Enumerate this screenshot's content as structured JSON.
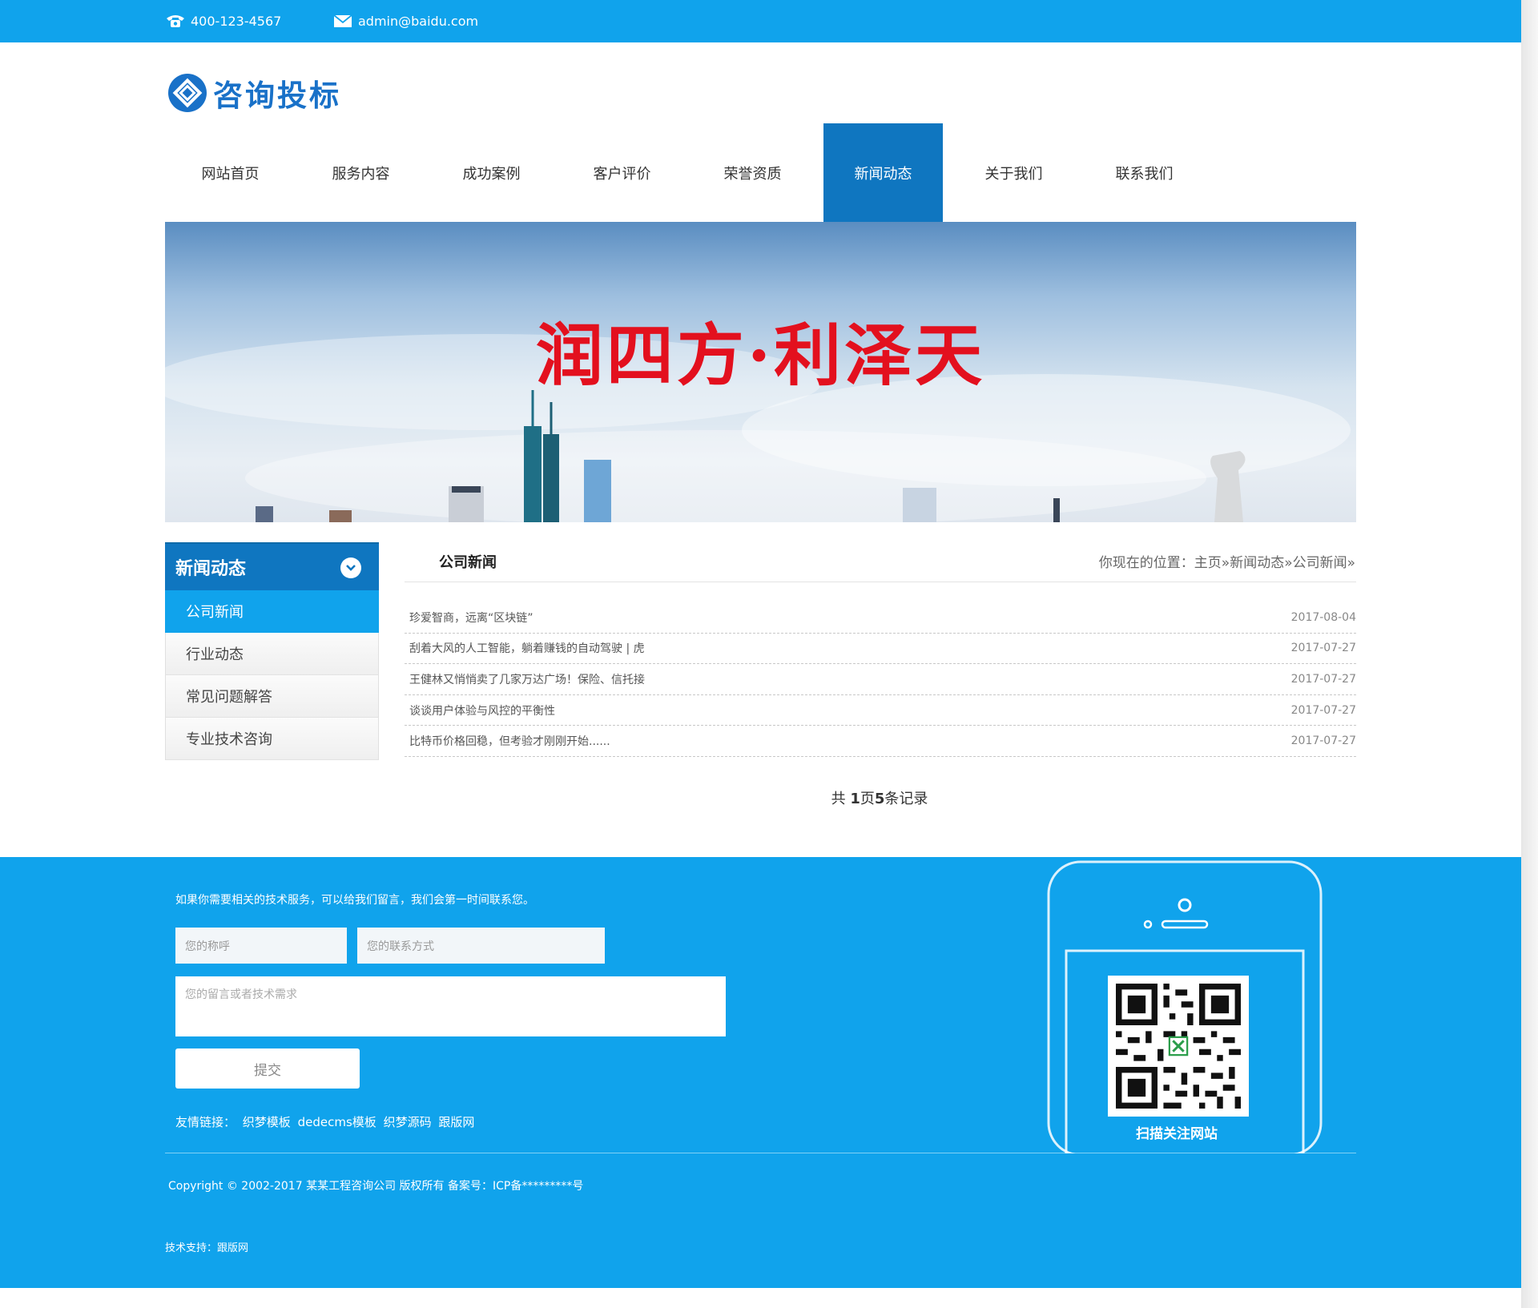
{
  "topbar": {
    "phone": "400-123-4567",
    "email": "admin@baidu.com"
  },
  "logo": {
    "text": "咨询投标"
  },
  "nav": [
    {
      "label": "网站首页"
    },
    {
      "label": "服务内容"
    },
    {
      "label": "成功案例"
    },
    {
      "label": "客户评价"
    },
    {
      "label": "荣誉资质"
    },
    {
      "label": "新闻动态",
      "active": true
    },
    {
      "label": "关于我们"
    },
    {
      "label": "联系我们"
    }
  ],
  "banner": {
    "slogan": "润四方·利泽天"
  },
  "sidebar": {
    "title": "新闻动态",
    "items": [
      {
        "label": "公司新闻",
        "active": true
      },
      {
        "label": "行业动态"
      },
      {
        "label": "常见问题解答"
      },
      {
        "label": "专业技术咨询"
      }
    ]
  },
  "content": {
    "title": "公司新闻",
    "breadcrumb": "你现在的位置：主页»新闻动态»公司新闻»",
    "news": [
      {
        "title": "珍爱智商，远离“区块链”",
        "date": "2017-08-04"
      },
      {
        "title": "刮着大风的人工智能，躺着赚钱的自动驾驶 | 虎",
        "date": "2017-07-27"
      },
      {
        "title": "王健林又悄悄卖了几家万达广场！保险、信托接",
        "date": "2017-07-27"
      },
      {
        "title": "谈谈用户体验与风控的平衡性",
        "date": "2017-07-27"
      },
      {
        "title": "比特币价格回稳，但考验才刚刚开始......",
        "date": "2017-07-27"
      }
    ],
    "pager": {
      "prefix": "共 ",
      "pages": "1",
      "mid": "页",
      "records": "5",
      "suffix": "条记录"
    }
  },
  "footer": {
    "tip": "如果你需要相关的技术服务，可以给我们留言，我们会第一时间联系您。",
    "name_placeholder": "您的称呼",
    "contact_placeholder": "您的联系方式",
    "message_placeholder": "您的留言或者技术需求",
    "submit_label": "提交",
    "links_label": "友情链接：",
    "links": [
      "织梦模板",
      "dedecms模板",
      "织梦源码",
      "跟版网"
    ],
    "copyright": "Copyright © 2002-2017 某某工程咨询公司 版权所有   备案号：ICP备*********号",
    "tech": "技术支持：跟版网",
    "qr_caption": "扫描关注网站"
  },
  "colors": {
    "primary": "#10a3ec",
    "nav_active": "#0f76c0",
    "slogan": "#e3101e"
  }
}
